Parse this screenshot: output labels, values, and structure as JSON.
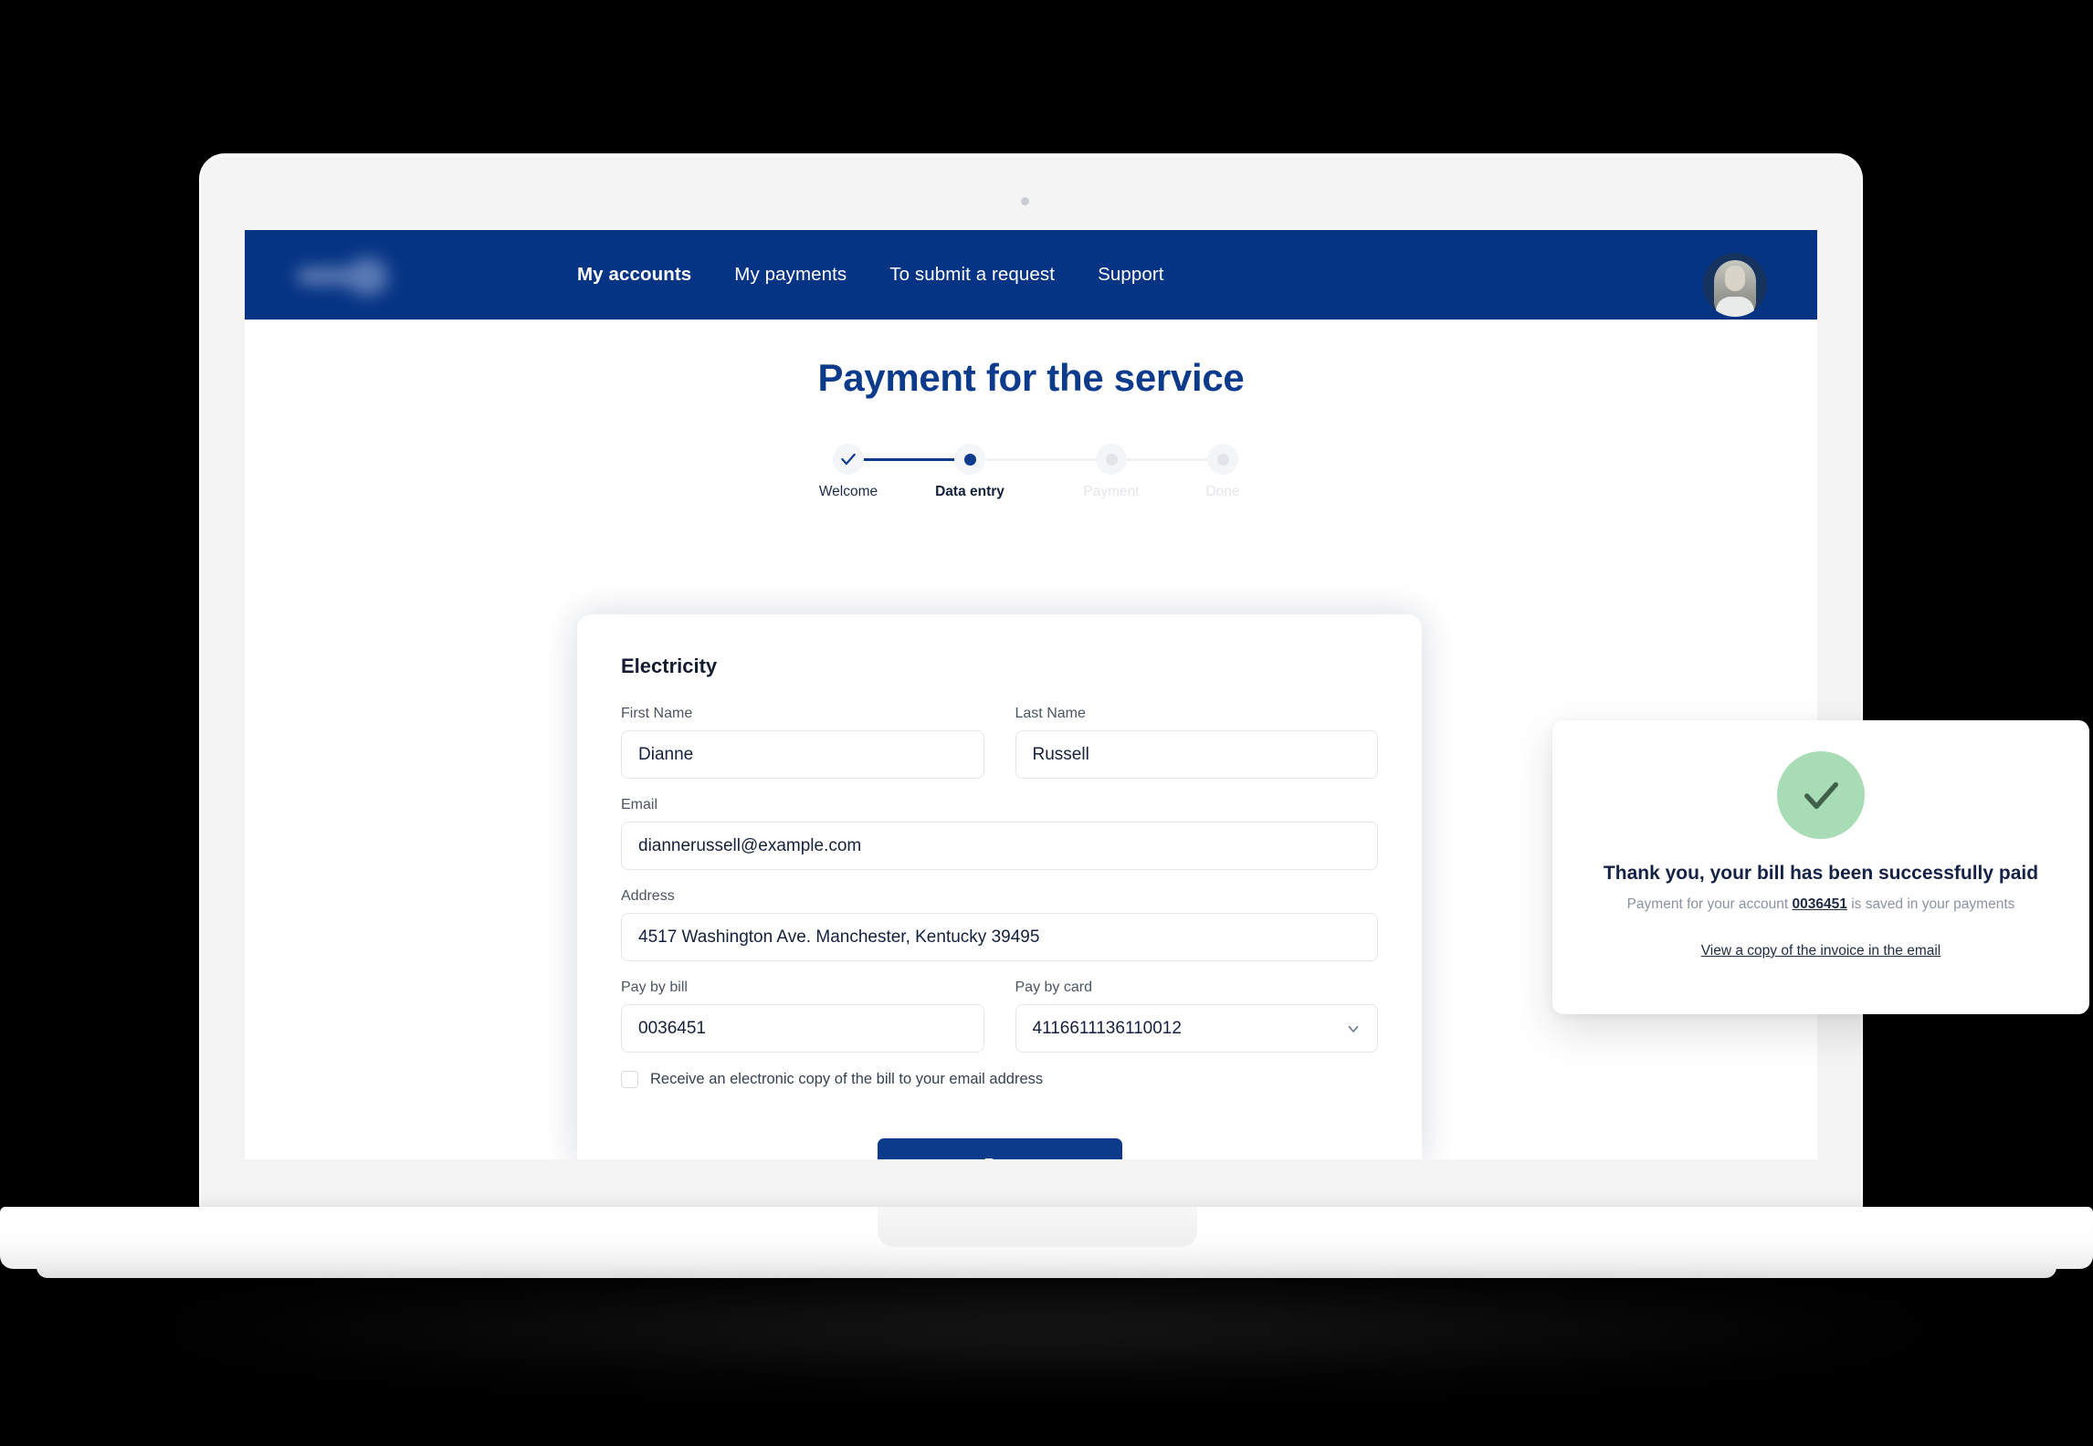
{
  "nav": {
    "logo_alt": "company-logo",
    "links": [
      {
        "label": "My accounts",
        "active": true
      },
      {
        "label": "My payments",
        "active": false
      },
      {
        "label": "To submit a request",
        "active": false
      },
      {
        "label": "Support",
        "active": false
      }
    ],
    "avatar_alt": "user-avatar"
  },
  "page": {
    "title": "Payment for the service"
  },
  "stepper": {
    "steps": [
      {
        "label": "Welcome",
        "state": "done"
      },
      {
        "label": "Data entry",
        "state": "current"
      },
      {
        "label": "Payment",
        "state": "future"
      },
      {
        "label": "Done",
        "state": "future"
      }
    ]
  },
  "form": {
    "title": "Electricity",
    "first_name": {
      "label": "First Name",
      "value": "Dianne"
    },
    "last_name": {
      "label": "Last Name",
      "value": "Russell"
    },
    "email": {
      "label": "Email",
      "value": "diannerussell@example.com"
    },
    "address": {
      "label": "Address",
      "value": "4517 Washington Ave. Manchester, Kentucky 39495"
    },
    "pay_by_bill": {
      "label": "Pay by bill",
      "value": "0036451"
    },
    "pay_by_card": {
      "label": "Pay by card",
      "value": "4116611136110012"
    },
    "checkbox_label": "Receive an electronic copy of the bill to your email address",
    "checkbox_checked": false,
    "submit_label": "Pay"
  },
  "notification": {
    "title": "Thank you, your bill has been successfully paid",
    "sub_prefix": "Payment for your account",
    "account": "0036451",
    "sub_suffix": "is saved in your payments",
    "link": "View a copy of the invoice in the email"
  },
  "colors": {
    "brand_blue": "#063485",
    "title_blue": "#0d3b8c",
    "success_green": "#a8dcb5",
    "check_green": "#41604a"
  }
}
